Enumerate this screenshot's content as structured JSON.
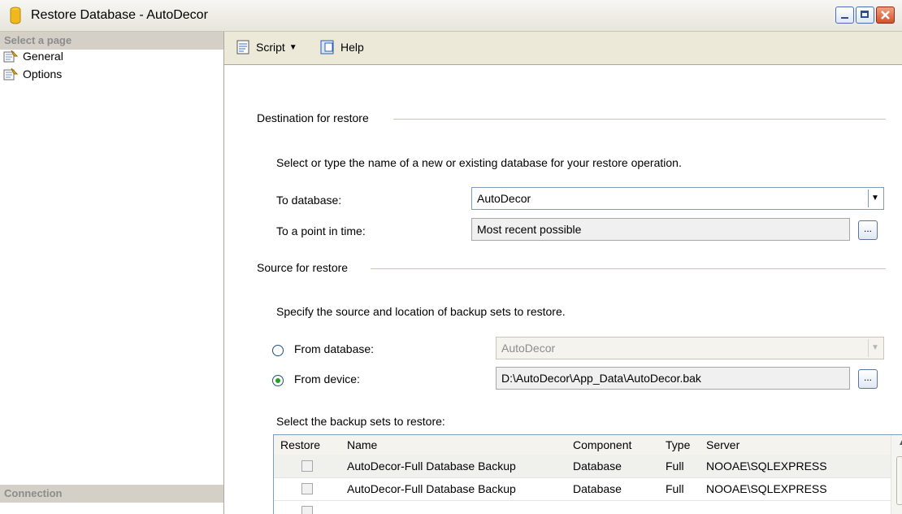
{
  "window": {
    "title": "Restore Database - AutoDecor"
  },
  "left_pane": {
    "select_page_header": "Select a page",
    "pages": [
      {
        "label": "General"
      },
      {
        "label": "Options"
      }
    ],
    "connection_header": "Connection"
  },
  "toolbar": {
    "script_label": "Script",
    "help_label": "Help"
  },
  "destination": {
    "group_label": "Destination for restore",
    "instruction": "Select or type the name of a new or existing database for your restore operation.",
    "to_database_label": "To database:",
    "to_database_value": "AutoDecor",
    "point_in_time_label": "To a point in time:",
    "point_in_time_value": "Most recent possible",
    "browse_label": "..."
  },
  "source": {
    "group_label": "Source for restore",
    "instruction": "Specify the source and location of backup sets to restore.",
    "from_database_label": "From database:",
    "from_database_value": "AutoDecor",
    "from_device_label": "From device:",
    "from_device_value": "D:\\AutoDecor\\App_Data\\AutoDecor.bak",
    "browse_label": "..."
  },
  "backup_sets": {
    "label": "Select the backup sets to restore:",
    "columns": [
      "Restore",
      "Name",
      "Component",
      "Type",
      "Server"
    ],
    "rows": [
      {
        "name": "AutoDecor-Full Database Backup",
        "component": "Database",
        "type": "Full",
        "server": "NOOAE\\SQLEXPRESS"
      },
      {
        "name": "AutoDecor-Full Database Backup",
        "component": "Database",
        "type": "Full",
        "server": "NOOAE\\SQLEXPRESS"
      }
    ]
  }
}
